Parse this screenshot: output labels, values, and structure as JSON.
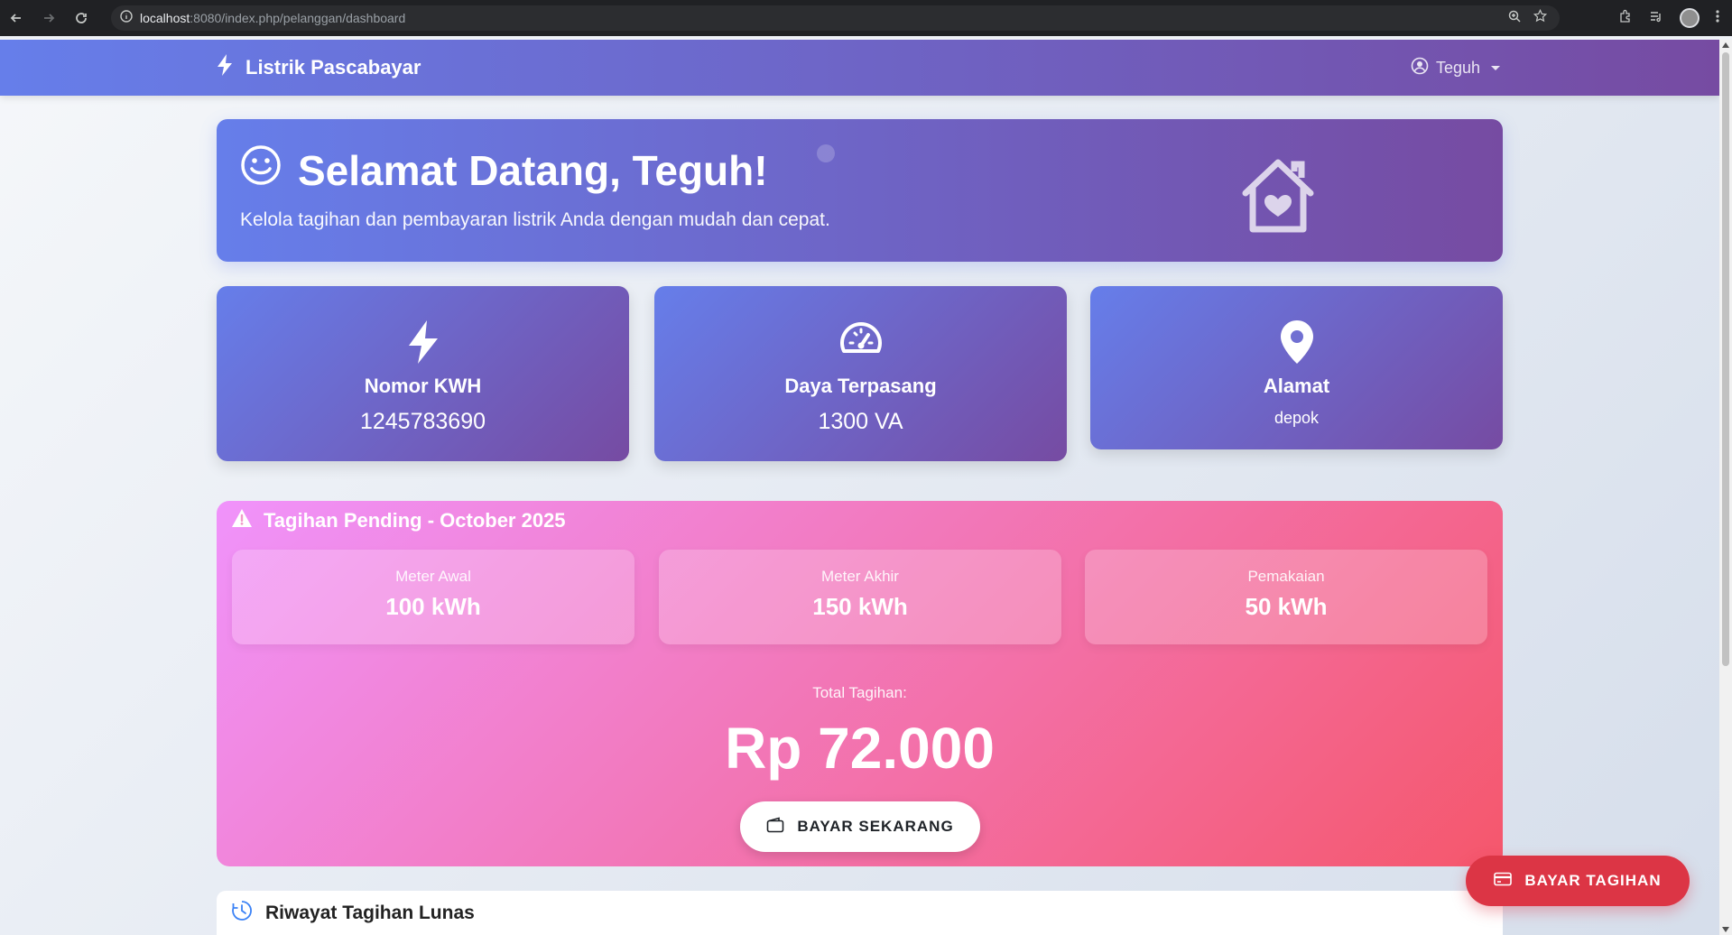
{
  "browser": {
    "url_host": "localhost",
    "url_path": ":8080/index.php/pelanggan/dashboard"
  },
  "navbar": {
    "brand": "Listrik Pascabayar",
    "user": "Teguh"
  },
  "welcome": {
    "title": "Selamat Datang, Teguh!",
    "subtitle": "Kelola tagihan dan pembayaran listrik Anda dengan mudah dan cepat."
  },
  "info_cards": [
    {
      "label": "Nomor KWH",
      "value": "1245783690",
      "icon": "bolt-icon"
    },
    {
      "label": "Daya Terpasang",
      "value": "1300 VA",
      "icon": "speedometer-icon"
    },
    {
      "label": "Alamat",
      "value": "depok",
      "icon": "map-pin-icon"
    }
  ],
  "pending": {
    "title": "Tagihan Pending - October 2025",
    "meters": [
      {
        "label": "Meter Awal",
        "value": "100 kWh"
      },
      {
        "label": "Meter Akhir",
        "value": "150 kWh"
      },
      {
        "label": "Pemakaian",
        "value": "50 kWh"
      }
    ],
    "total_label": "Total Tagihan:",
    "total_value": "Rp 72.000",
    "pay_button": "BAYAR SEKARANG"
  },
  "history": {
    "title": "Riwayat Tagihan Lunas"
  },
  "fab": {
    "label": "BAYAR TAGIHAN"
  },
  "colors": {
    "primary_gradient_start": "#667eea",
    "primary_gradient_end": "#764ba2",
    "pending_gradient_start": "#f093fb",
    "pending_gradient_end": "#f5576c",
    "fab": "#dc3545"
  }
}
